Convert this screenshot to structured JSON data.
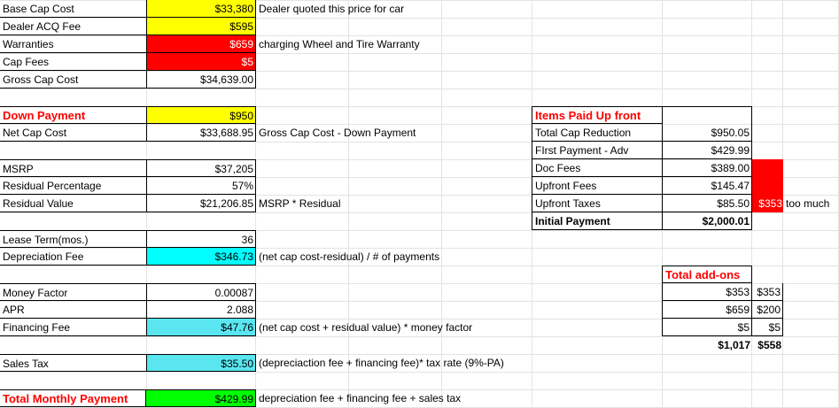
{
  "cost": {
    "base_cap_cost": {
      "label": "Base Cap Cost",
      "value": "$33,380",
      "note": "Dealer quoted this price for car"
    },
    "dealer_acq_fee": {
      "label": "Dealer ACQ Fee",
      "value": "$595"
    },
    "warranties": {
      "label": "Warranties",
      "value": "$659",
      "note": "charging Wheel and Tire Warranty"
    },
    "cap_fees": {
      "label": "Cap Fees",
      "value": "$5"
    },
    "gross_cap_cost": {
      "label": "Gross Cap Cost",
      "value": "$34,639.00"
    }
  },
  "down": {
    "down_payment": {
      "label": "Down Payment",
      "value": "$950"
    },
    "net_cap_cost": {
      "label": "Net Cap Cost",
      "value": "$33,688.95",
      "note": "Gross Cap Cost - Down Payment"
    }
  },
  "residual": {
    "msrp": {
      "label": "MSRP",
      "value": "$37,205"
    },
    "residual_percentage": {
      "label": "Residual Percentage",
      "value": "57%"
    },
    "residual_value": {
      "label": "Residual Value",
      "value": "$21,206.85",
      "note": "MSRP * Residual"
    }
  },
  "term": {
    "lease_term": {
      "label": "Lease Term(mos.)",
      "value": "36"
    },
    "depreciation_fee": {
      "label": "Depreciation Fee",
      "value": "$346.73",
      "note": "(net cap cost-residual) / # of payments"
    }
  },
  "finance": {
    "money_factor": {
      "label": "Money Factor",
      "value": "0.00087"
    },
    "apr": {
      "label": "APR",
      "value": "2.088"
    },
    "financing_fee": {
      "label": "Financing Fee",
      "value": "$47.76",
      "note": "(net cap cost + residual value) * money factor"
    }
  },
  "tax": {
    "sales_tax": {
      "label": "Sales Tax",
      "value": "$35.50",
      "note": "(depreciaction fee + financing fee)* tax rate (9%-PA)"
    }
  },
  "total": {
    "total_monthly_payment": {
      "label": "Total Monthly Payment",
      "value": "$429.99",
      "note": "depreciation fee + financing fee + sales tax"
    }
  },
  "upfront": {
    "title": "Items Paid Up front",
    "rows": [
      {
        "label": "Total Cap Reduction",
        "value": "$950.05"
      },
      {
        "label": "FIrst Payment - Adv",
        "value": "$429.99"
      },
      {
        "label": "Doc Fees",
        "value": "$389.00"
      },
      {
        "label": "Upfront Fees",
        "value": "$145.47"
      },
      {
        "label": "Upfront Taxes",
        "value": "$85.50",
        "extra": "$353",
        "extra_note": "too much"
      }
    ],
    "initial_payment": {
      "label": "Initial Payment",
      "value": "$2,000.01"
    }
  },
  "addons": {
    "title": "Total add-ons",
    "rows": [
      {
        "a": "$353",
        "b": "$353"
      },
      {
        "a": "$659",
        "b": "$200"
      },
      {
        "a": "$5",
        "b": "$5"
      }
    ],
    "totals": {
      "a": "$1,017",
      "b": "$558"
    }
  },
  "colors": {
    "highlight_yellow": "#ffff00",
    "highlight_red": "#ff0000",
    "highlight_cyan": "#00ffff",
    "highlight_green": "#00ff00",
    "label_red": "#ff0000"
  }
}
